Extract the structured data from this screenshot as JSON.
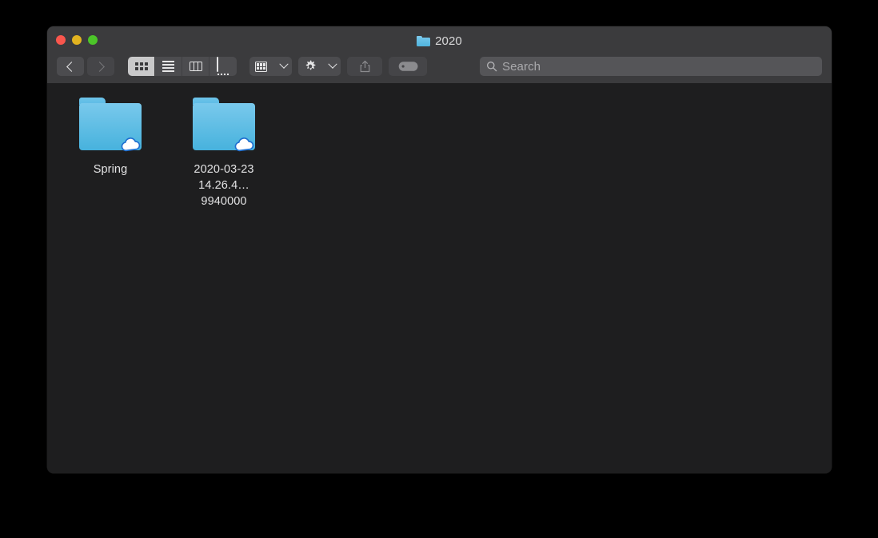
{
  "desktop": {
    "background_color": "#000000"
  },
  "window": {
    "title": "2020",
    "title_icon": "folder-icon",
    "background_color": "#1e1e1f",
    "titlebar_color": "#3b3b3d",
    "traffic_lights": [
      {
        "name": "close",
        "label": "Close",
        "color": "#f9564d"
      },
      {
        "name": "minimize",
        "label": "Minimize",
        "color": "#e2b320"
      },
      {
        "name": "maximize",
        "label": "Maximize",
        "color": "#4cc529"
      }
    ]
  },
  "toolbar": {
    "back": {
      "label": "Back",
      "icon": "chevron-left-icon",
      "enabled": true
    },
    "forward": {
      "label": "Forward",
      "icon": "chevron-right-icon",
      "enabled": false
    },
    "view_modes": [
      {
        "name": "icon-view",
        "label": "as Icons",
        "icon": "grid-icon",
        "selected": true
      },
      {
        "name": "list-view",
        "label": "as List",
        "icon": "list-icon",
        "selected": false
      },
      {
        "name": "column-view",
        "label": "as Columns",
        "icon": "columns-icon",
        "selected": false
      },
      {
        "name": "gallery-view",
        "label": "as Gallery",
        "icon": "gallery-icon",
        "selected": false
      }
    ],
    "arrange": {
      "label": "Group",
      "icon": "arrange-icon",
      "chevron": "chevron-down-icon"
    },
    "action": {
      "label": "Action",
      "icon": "gear-icon",
      "chevron": "chevron-down-icon"
    },
    "share": {
      "label": "Share",
      "icon": "share-icon",
      "enabled": false
    },
    "tags": {
      "label": "Tags",
      "icon": "tag-icon",
      "enabled": false
    }
  },
  "search": {
    "placeholder": "Search",
    "value": "",
    "icon": "search-icon"
  },
  "files": [
    {
      "name": "Spring",
      "label": "Spring",
      "kind": "folder",
      "badge": "icloud-cloud-icon"
    },
    {
      "name": "2020-03-23 14.26.4...9940000",
      "label": "2020-03-23\n14.26.4…9940000",
      "kind": "folder",
      "badge": "icloud-cloud-icon"
    }
  ]
}
